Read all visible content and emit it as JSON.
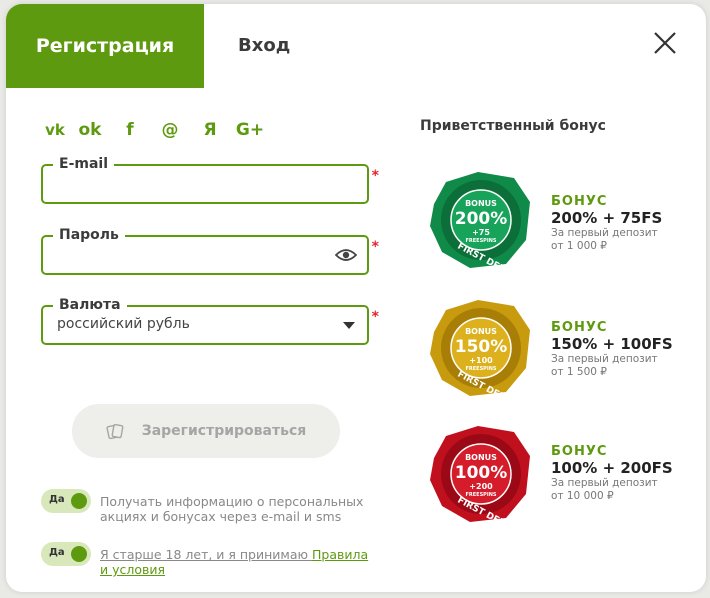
{
  "tabs": {
    "register": "Регистрация",
    "login": "Вход"
  },
  "socials": [
    {
      "name": "vk-icon",
      "glyph": "vk"
    },
    {
      "name": "odnoklassniki-icon",
      "glyph": "ok"
    },
    {
      "name": "facebook-icon",
      "glyph": "f"
    },
    {
      "name": "mail-icon",
      "glyph": "@"
    },
    {
      "name": "yandex-icon",
      "glyph": "Я"
    },
    {
      "name": "google-plus-icon",
      "glyph": "G+"
    }
  ],
  "form": {
    "email_label": "E-mail",
    "email_value": "",
    "password_label": "Пароль",
    "password_value": "",
    "currency_label": "Валюта",
    "currency_value": "российский рубль",
    "required_mark": "*",
    "submit_label": "Зарегистрироваться"
  },
  "consents": [
    {
      "toggle": "Да",
      "text": "Получать информацию о персональных акциях и бонусах через e-mail и sms"
    },
    {
      "toggle": "Да",
      "text_before": "Я старше 18 лет, и я принимаю ",
      "link": "Правила и условия"
    }
  ],
  "bonus_title": "Приветственный бонус",
  "bonuses": [
    {
      "badge_top": "BONUS",
      "badge_pct": "200%",
      "badge_fs": "+75",
      "badge_fs_lbl": "FREESPINS",
      "badge_ring": "FIRST DEPOSIT",
      "color": "#0f8a48",
      "label": "БОНУС",
      "amount": "200% + 75FS",
      "desc": "За первый депозит",
      "min": "от 1 000 ₽"
    },
    {
      "badge_top": "BONUS",
      "badge_pct": "150%",
      "badge_fs": "+100",
      "badge_fs_lbl": "FREESPINS",
      "badge_ring": "FIRST DEPOSIT",
      "color": "#c89b0e",
      "label": "БОНУС",
      "amount": "150% + 100FS",
      "desc": "За первый депозит",
      "min": "от 1 500 ₽"
    },
    {
      "badge_top": "BONUS",
      "badge_pct": "100%",
      "badge_fs": "+200",
      "badge_fs_lbl": "FREESPINS",
      "badge_ring": "FIRST DEPOSIT",
      "color": "#c0101e",
      "label": "БОНУС",
      "amount": "100% + 200FS",
      "desc": "За первый депозит",
      "min": "от 10 000 ₽"
    }
  ]
}
